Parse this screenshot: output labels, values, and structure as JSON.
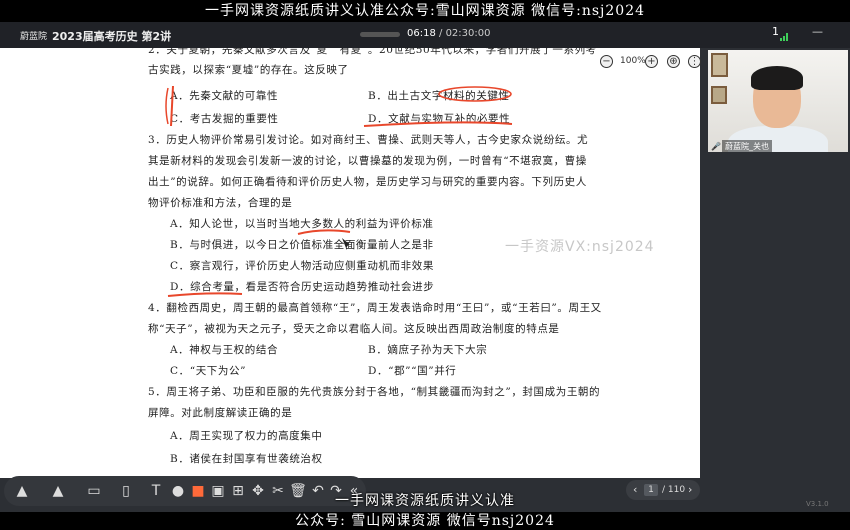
{
  "banner_top": "一手网课资源纸质讲义认准公众号:雪山网课资源 微信号:nsj2024",
  "titlebar": {
    "logo": "蔚蓝院",
    "course": "2023届高考历史 第2讲",
    "time_current": "06:18",
    "time_total": "02:30:00",
    "count": "1",
    "minimize": "—"
  },
  "zoom": {
    "minus": "−",
    "value": "100%",
    "plus": "+",
    "extra1": "⊕",
    "extra2": "⋮"
  },
  "document": {
    "lines": [
      "2．关于夏朝，先秦文献多次言及“夏”“有夏”。20世纪50年代以来，学者们开展了一系列考",
      "古实践，以探索“夏墟”的存在。这反映了",
      "A．先秦文献的可靠性",
      "B．出土古文字材料的关键性",
      "C．考古发掘的重要性",
      "D．文献与实物互补的必要性",
      "3．历史人物评价常易引发讨论。如对商纣王、曹操、武则天等人，古今史家众说纷纭。尤",
      "其是新材料的发现会引发新一波的讨论，以曹操墓的发现为例，一时曾有“不堪寂寞，曹操",
      "出土”的说辞。如何正确看待和评价历史人物，是历史学习与研究的重要内容。下列历史人",
      "物评价标准和方法，合理的是",
      "A．知人论世，以当时当地大多数人的利益为评价标准",
      "B．与时俱进，以今日之价值标准全面衡量前人之是非",
      "C．察言观行，评价历史人物活动应侧重动机而非效果",
      "D．综合考量，看是否符合历史运动趋势推动社会进步",
      "4．翻检西周史，周王朝的最高首领称“王”，周王发表诰命时用“王曰”，或“王若曰”。周王又",
      "称“天子”，被视为天之元子，受天之命以君临人间。这反映出西周政治制度的特点是",
      "A．神权与王权的结合",
      "B．嫡庶子孙为天下大宗",
      "C．“天下为公”",
      "D．“郡”“国”并行",
      "5．周王将子弟、功臣和臣服的先代贵族分封于各地，“制其畿疆而沟封之”，封国成为王朝的",
      "屏障。对此制度解读正确的是",
      "A．周王实现了权力的高度集中",
      "B．诸侯在封国享有世袭统治权"
    ]
  },
  "camera": {
    "name": "蔚蓝院_关也"
  },
  "watermark_mid": "一手资源VX:nsj2024",
  "pager": {
    "current": "1",
    "total": "/ 110",
    "prev": "‹",
    "next": "›"
  },
  "version": "V3.1.0",
  "watermark_bottom": "一手网课资源纸质讲义认准",
  "banner_bottom": "公众号: 雪山网课资源 微信号nsj2024",
  "colors": {
    "annotation": "#e8472b",
    "stage": "#2c2f34",
    "toolbar": "#34373c"
  }
}
